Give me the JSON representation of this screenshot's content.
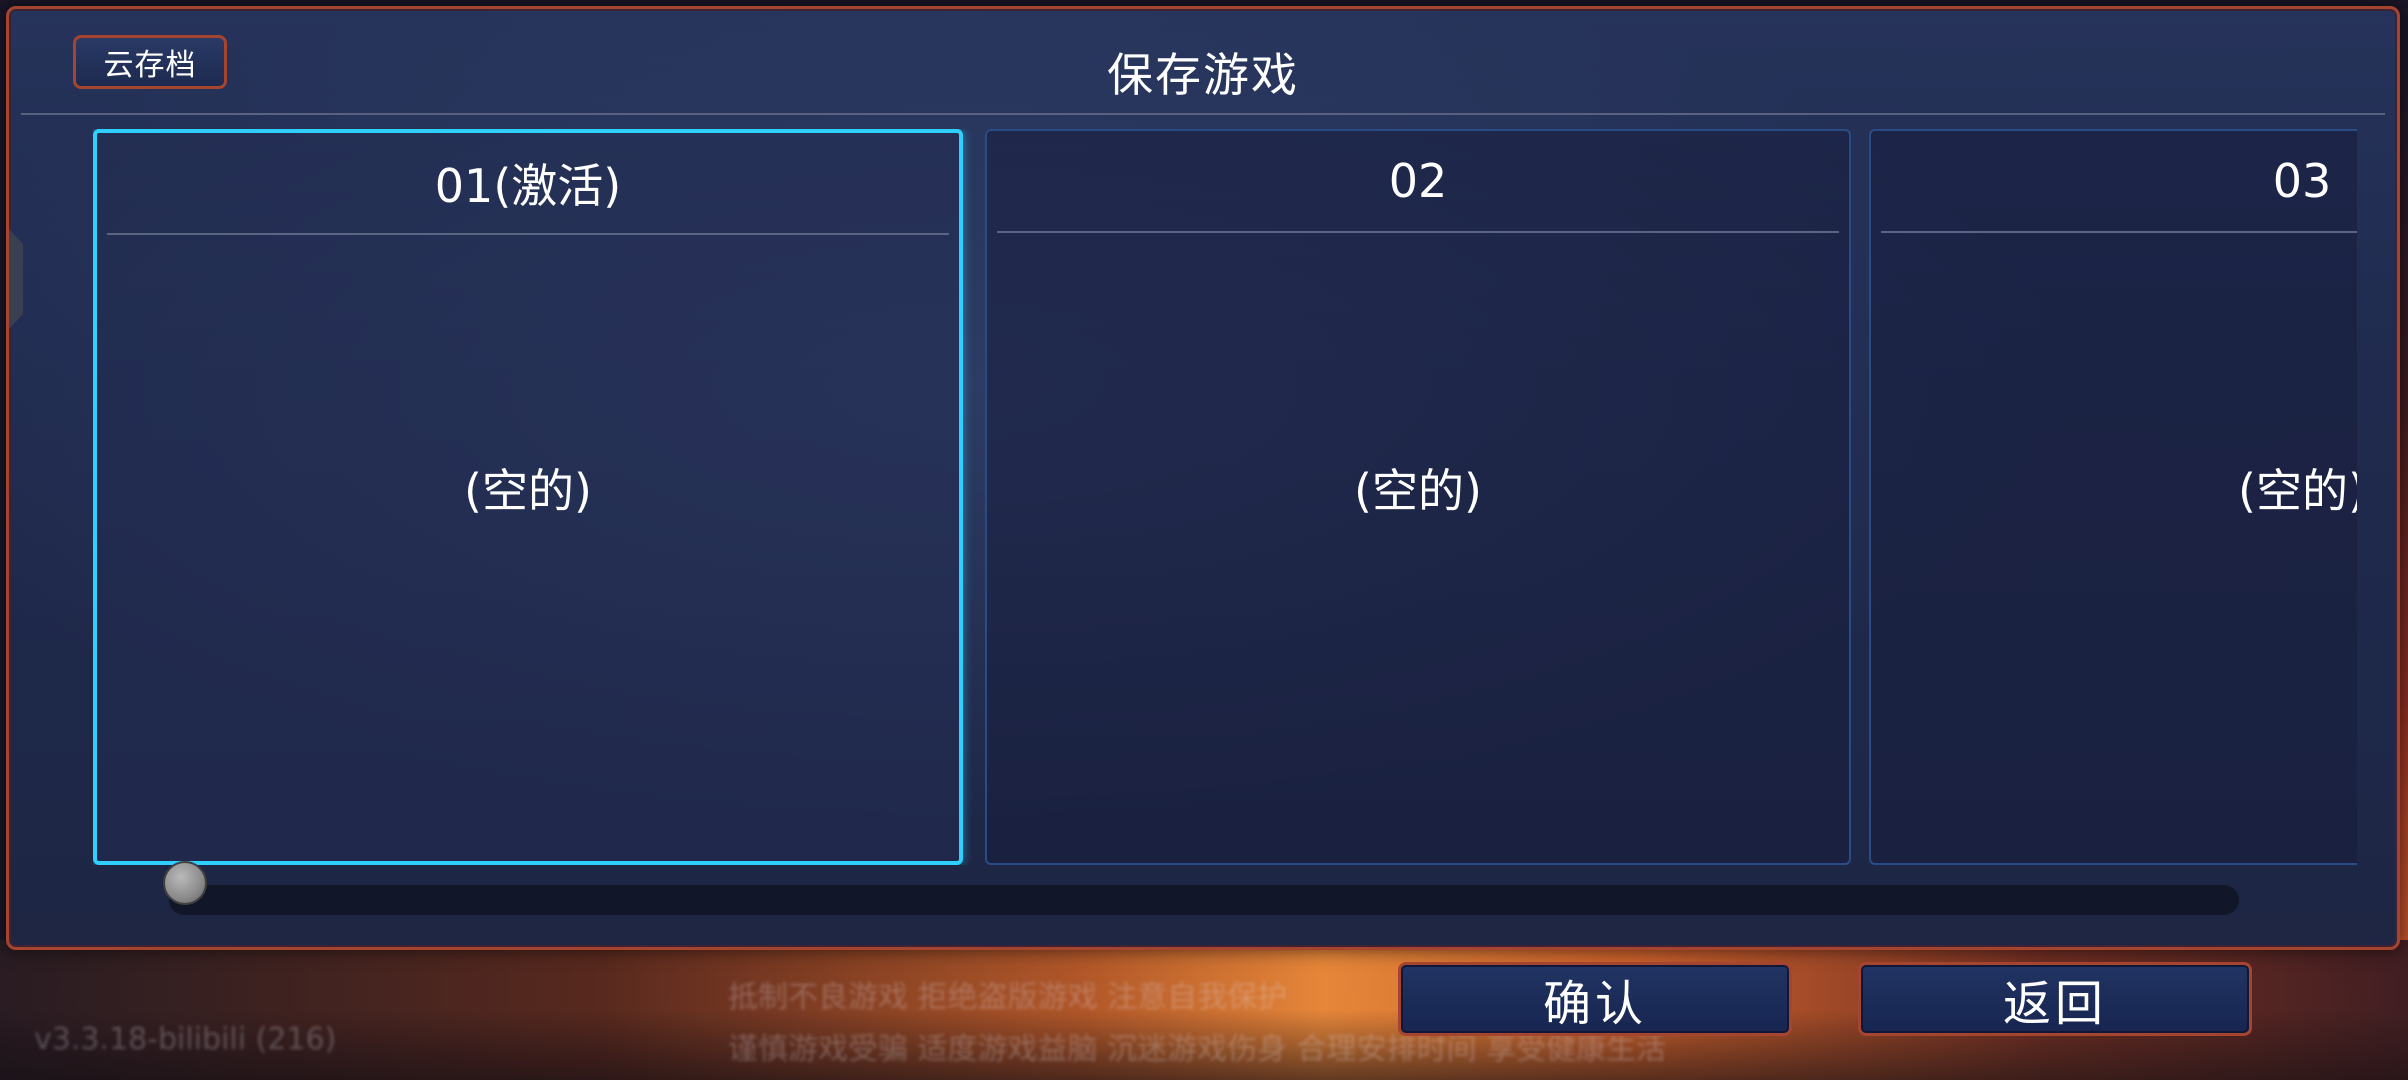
{
  "background": {
    "ticker_line_1": "抵制不良游戏  拒绝盗版游戏  注意自我保护",
    "ticker_line_2": "谨慎游戏受骗  适度游戏益脑  沉迷游戏伤身  合理安排时间  享受健康生活",
    "version": "v3.3.18-bilibili (216)"
  },
  "dialog": {
    "title": "保存游戏",
    "cloud_save_label": "云存档",
    "slots": [
      {
        "id": "01",
        "header": "01(激活)",
        "content": "(空的)",
        "active": true
      },
      {
        "id": "02",
        "header": "02",
        "content": "(空的)",
        "active": false
      },
      {
        "id": "03",
        "header": "03",
        "content": "(空的)",
        "active": false
      }
    ],
    "scroll": {
      "position": 0
    }
  },
  "buttons": {
    "confirm_label": "确认",
    "back_label": "返回"
  },
  "colors": {
    "frame_border": "#a5452f",
    "active_slot_border": "#2fd0ff",
    "slot_border": "#2a4c86",
    "panel_bg": "#1f2a4e"
  }
}
